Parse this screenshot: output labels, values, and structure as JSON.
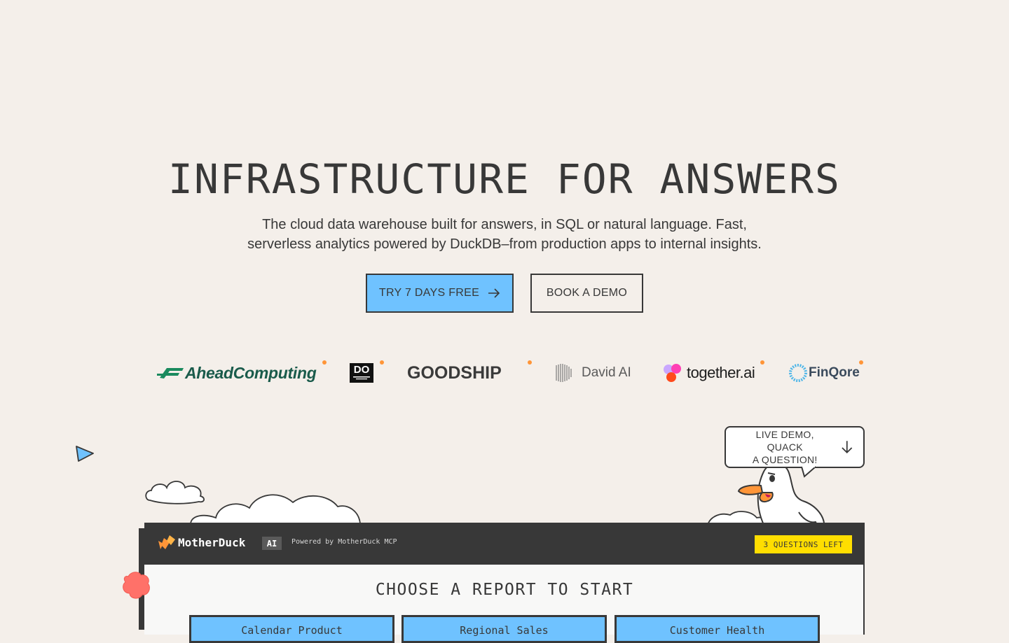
{
  "hero": {
    "title": "INFRASTRUCTURE FOR ANSWERS",
    "subtitle_line1": "The cloud data warehouse built for answers, in SQL or natural language. Fast,",
    "subtitle_line2": "serverless analytics powered by DuckDB–from production apps to internal insights.",
    "primary_cta": "TRY 7 DAYS FREE",
    "secondary_cta": "BOOK A DEMO"
  },
  "logos": {
    "ahead": "AheadComputing",
    "do_something": "DO",
    "goodship": "GOODSHIP",
    "david": "David AI",
    "together": "together.ai",
    "finqore": "FinQore"
  },
  "callout": {
    "line1": "LIVE DEMO, QUACK",
    "line2": "A QUESTION!"
  },
  "app": {
    "brand": "MotherDuck",
    "ai_badge": "AI",
    "powered_by": "Powered by MotherDuck MCP",
    "questions_left": "3 QUESTIONS LEFT",
    "choose_title": "CHOOSE A REPORT TO START",
    "reports": [
      "Calendar Product",
      "Regional Sales",
      "Customer Health"
    ]
  },
  "colors": {
    "background": "#f4efea",
    "primary_button": "#6fc2ff",
    "dark": "#383838",
    "badge_yellow": "#ffde00",
    "accent_orange": "#ff9538"
  }
}
